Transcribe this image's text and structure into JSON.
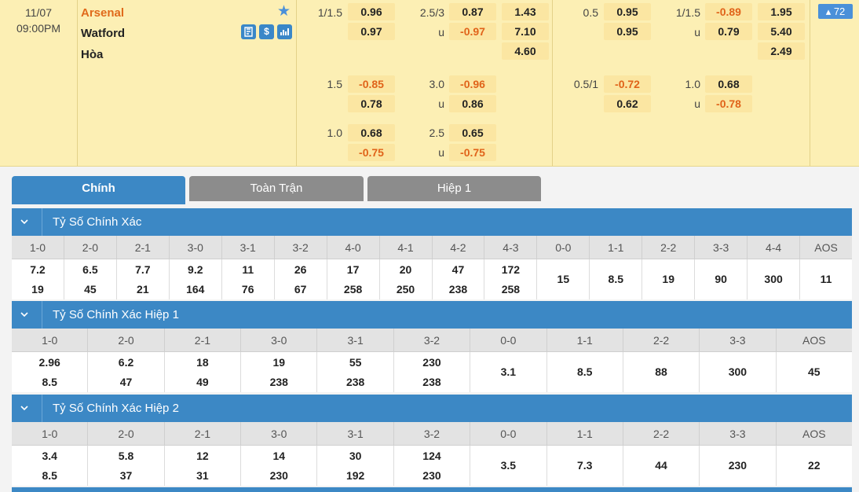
{
  "match": {
    "date": "11/07",
    "time": "09:00PM",
    "home": "Arsenal",
    "away": "Watford",
    "draw": "Hòa",
    "badge": "72",
    "icons": [
      "star-icon",
      "stats-book-icon",
      "money-icon",
      "bar-chart-icon"
    ],
    "lines": [
      {
        "ah": {
          "line": "1/1.5",
          "home": "0.96",
          "away": "0.97"
        },
        "ou": {
          "line": "2.5/3",
          "over": "0.87",
          "u": "u",
          "under": "-0.97"
        },
        "x12": {
          "home": "1.43",
          "away": "7.10",
          "draw": "4.60"
        },
        "h1_ah": {
          "line": "0.5",
          "home": "0.95",
          "away": "0.95"
        },
        "h1_ou": {
          "line": "1/1.5",
          "over": "-0.89",
          "u": "u",
          "under": "0.79"
        },
        "h1_x12": {
          "home": "1.95",
          "away": "5.40",
          "draw": "2.49"
        }
      },
      {
        "ah": {
          "line": "1.5",
          "home": "-0.85",
          "away": "0.78"
        },
        "ou": {
          "line": "3.0",
          "over": "-0.96",
          "u": "u",
          "under": "0.86"
        },
        "h1_ah": {
          "line": "0.5/1",
          "home": "-0.72",
          "away": "0.62"
        },
        "h1_ou": {
          "line": "1.0",
          "over": "0.68",
          "u": "u",
          "under": "-0.78"
        }
      },
      {
        "ah": {
          "line": "1.0",
          "home": "0.68",
          "away": "-0.75"
        },
        "ou": {
          "line": "2.5",
          "over": "0.65",
          "u": "u",
          "under": "-0.75"
        }
      }
    ]
  },
  "tabs": [
    {
      "label": "Chính",
      "active": true
    },
    {
      "label": "Toàn Trận",
      "active": false
    },
    {
      "label": "Hiệp 1",
      "active": false
    }
  ],
  "sections": [
    {
      "title": "Tỷ Số Chính Xác",
      "scores": [
        "1-0",
        "2-0",
        "2-1",
        "3-0",
        "3-1",
        "3-2",
        "4-0",
        "4-1",
        "4-2",
        "4-3",
        "0-0",
        "1-1",
        "2-2",
        "3-3",
        "4-4",
        "AOS"
      ],
      "values": [
        [
          "7.2",
          "19"
        ],
        [
          "6.5",
          "45"
        ],
        [
          "7.7",
          "21"
        ],
        [
          "9.2",
          "164"
        ],
        [
          "11",
          "76"
        ],
        [
          "26",
          "67"
        ],
        [
          "17",
          "258"
        ],
        [
          "20",
          "250"
        ],
        [
          "47",
          "238"
        ],
        [
          "172",
          "258"
        ],
        [
          "15"
        ],
        [
          "8.5"
        ],
        [
          "19"
        ],
        [
          "90"
        ],
        [
          "300"
        ],
        [
          "11"
        ]
      ]
    },
    {
      "title": "Tỷ Số Chính Xác Hiệp 1",
      "scores": [
        "1-0",
        "2-0",
        "2-1",
        "3-0",
        "3-1",
        "3-2",
        "0-0",
        "1-1",
        "2-2",
        "3-3",
        "AOS"
      ],
      "values": [
        [
          "2.96",
          "8.5"
        ],
        [
          "6.2",
          "47"
        ],
        [
          "18",
          "49"
        ],
        [
          "19",
          "238"
        ],
        [
          "55",
          "238"
        ],
        [
          "230",
          "238"
        ],
        [
          "3.1"
        ],
        [
          "8.5"
        ],
        [
          "88"
        ],
        [
          "300"
        ],
        [
          "45"
        ]
      ]
    },
    {
      "title": "Tỷ Số Chính Xác Hiệp 2",
      "scores": [
        "1-0",
        "2-0",
        "2-1",
        "3-0",
        "3-1",
        "3-2",
        "0-0",
        "1-1",
        "2-2",
        "3-3",
        "AOS"
      ],
      "values": [
        [
          "3.4",
          "8.5"
        ],
        [
          "5.8",
          "37"
        ],
        [
          "12",
          "31"
        ],
        [
          "14",
          "230"
        ],
        [
          "30",
          "192"
        ],
        [
          "124",
          "230"
        ],
        [
          "3.5"
        ],
        [
          "7.3"
        ],
        [
          "44"
        ],
        [
          "230"
        ],
        [
          "22"
        ]
      ]
    }
  ]
}
